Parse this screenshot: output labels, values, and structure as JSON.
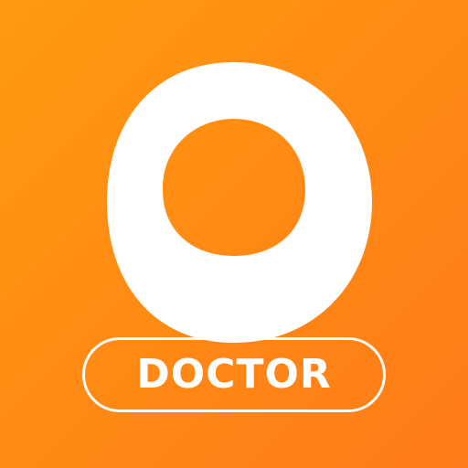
{
  "app_icon": {
    "badge_label": "DOCTOR",
    "logo_icon": "orange-fruit-ring-icon",
    "colors": {
      "background_start": "#FF9A10",
      "background_end": "#FF7A18",
      "foreground": "#FFFFFF"
    }
  }
}
